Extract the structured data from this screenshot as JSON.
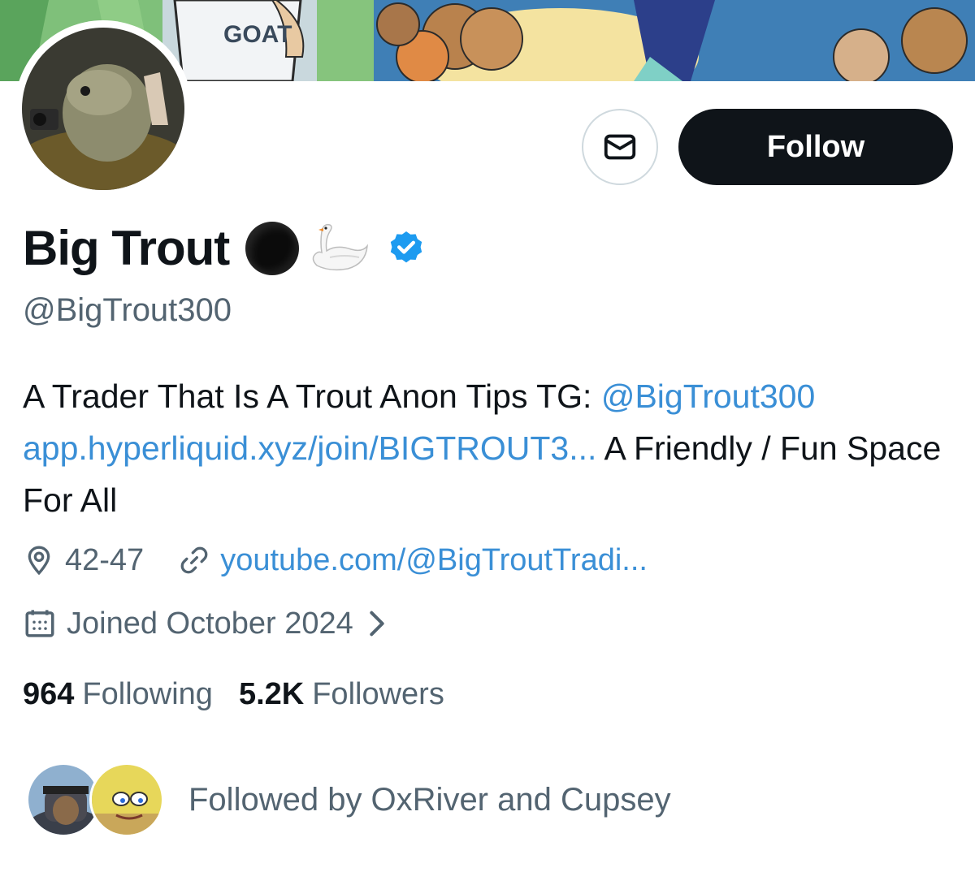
{
  "profile": {
    "name": "Big Trout",
    "handle": "@BigTrout300",
    "follow_label": "Follow",
    "banner_text": "GOAT",
    "emoji_names": [
      "black-circle-emoji",
      "swan-emoji"
    ],
    "verified": true
  },
  "bio": {
    "text1": "A Trader That Is A Trout Anon Tips TG: ",
    "mention": "@BigTrout300",
    "link": "app.hyperliquid.xyz/join/BIGTROUT3...",
    "text2": " A Friendly / Fun Space For All"
  },
  "meta": {
    "location": "42-47",
    "website": "youtube.com/@BigTroutTradi...",
    "joined": "Joined October 2024"
  },
  "stats": {
    "following_count": "964",
    "following_label": "Following",
    "followers_count": "5.2K",
    "followers_label": "Followers"
  },
  "followed_by": {
    "text": "Followed by OxRiver and Cupsey"
  },
  "colors": {
    "link": "#3a8fd6",
    "secondary_text": "#536471",
    "follow_button": "#0f1419",
    "verified_badge": "#1d9bf0"
  }
}
